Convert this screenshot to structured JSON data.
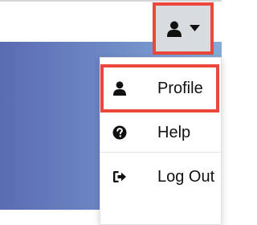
{
  "header": {
    "user_menu": {
      "icon": "user-icon",
      "caret_icon": "caret-down-icon",
      "highlight_color": "#e9483b"
    }
  },
  "dropdown": {
    "items": [
      {
        "label": "Profile",
        "icon": "user-icon",
        "highlighted": true
      },
      {
        "label": "Help",
        "icon": "question-circle-icon",
        "highlighted": false
      },
      {
        "label": "Log Out",
        "icon": "sign-out-icon",
        "highlighted": false
      }
    ]
  },
  "colors": {
    "highlight": "#e9483b",
    "button_bg": "#d9dcdf",
    "hero_gradient_start": "#5b6cb2",
    "hero_gradient_end": "#86aad7"
  }
}
